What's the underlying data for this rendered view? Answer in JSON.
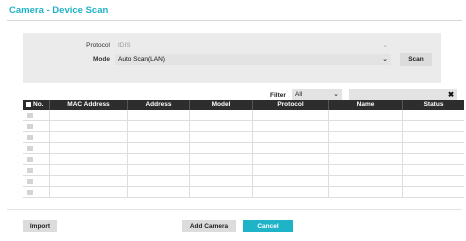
{
  "dialog": {
    "title": "Camera - Device Scan"
  },
  "settings": {
    "protocol_label": "Protocol",
    "protocol_value": "IDIS",
    "mode_label": "Mode",
    "mode_value": "Auto Scan(LAN)",
    "scan_label": "Scan"
  },
  "filter": {
    "label": "Filter",
    "value": "All",
    "search_value": ""
  },
  "table": {
    "columns": [
      "No.",
      "MAC Address",
      "Address",
      "Model",
      "Protocol",
      "Name",
      "Status"
    ],
    "rows": [
      [
        "",
        "",
        "",
        "",
        "",
        "",
        ""
      ],
      [
        "",
        "",
        "",
        "",
        "",
        "",
        ""
      ],
      [
        "",
        "",
        "",
        "",
        "",
        "",
        ""
      ],
      [
        "",
        "",
        "",
        "",
        "",
        "",
        ""
      ],
      [
        "",
        "",
        "",
        "",
        "",
        "",
        ""
      ],
      [
        "",
        "",
        "",
        "",
        "",
        "",
        ""
      ],
      [
        "",
        "",
        "",
        "",
        "",
        "",
        ""
      ],
      [
        "",
        "",
        "",
        "",
        "",
        "",
        ""
      ]
    ]
  },
  "footer": {
    "import_label": "Import",
    "add_camera_label": "Add Camera",
    "cancel_label": "Cancel"
  },
  "colors": {
    "accent": "#1fb3c8",
    "header_bg": "#2d2d2d",
    "panel_bg": "#ebebeb"
  },
  "icons": {
    "dropdown": "chevron-down-icon",
    "clear": "close-icon"
  }
}
